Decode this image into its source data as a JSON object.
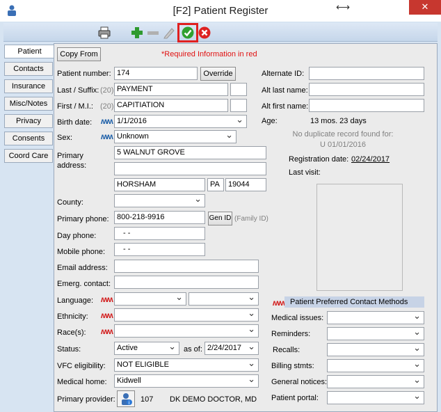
{
  "window": {
    "title": "[F2] Patient Register",
    "restore_glyph": "⟷",
    "close_glyph": "✕"
  },
  "toolbar": {
    "icons": [
      "printer-icon",
      "add-icon",
      "remove-icon",
      "edit-icon",
      "save-check-icon",
      "cancel-icon"
    ]
  },
  "tabs": [
    "Patient",
    "Contacts",
    "Insurance",
    "Misc/Notes",
    "Privacy",
    "Consents",
    "Coord Care"
  ],
  "top": {
    "copy_from": "Copy From",
    "required_note": "*Required Information in red"
  },
  "labels": {
    "patient_number": "Patient number:",
    "last_suffix": "Last / Suffix:",
    "first_mi": "First / M.I.:",
    "birth_date": "Birth date:",
    "sex": "Sex:",
    "primary_address": "Primary\naddress:",
    "county": "County:",
    "primary_phone": "Primary phone:",
    "day_phone": "Day phone:",
    "mobile_phone": "Mobile phone:",
    "email": "Email address:",
    "emerg": "Emerg. contact:",
    "language": "Language:",
    "ethnicity": "Ethnicity:",
    "race": "Race(s):",
    "status": "Status:",
    "as_of": "as of:",
    "vfc": "VFC eligibility:",
    "medical_home": "Medical home:",
    "primary_provider": "Primary provider:",
    "max20a": "(20)",
    "max20b": "(20)",
    "alternate_id": "Alternate ID:",
    "alt_last": "Alt last name:",
    "alt_first": "Alt first name:",
    "age": "Age:",
    "registration_date": "Registration date:",
    "last_visit": "Last visit:",
    "family_id": "(Family ID)"
  },
  "values": {
    "patient_number": "174",
    "last_name": "PAYMENT",
    "first_name": "CAPITIATION",
    "birth_date": "1/1/2016",
    "sex": "Unknown",
    "address1": "5 WALNUT GROVE",
    "city": "HORSHAM",
    "state": "PA",
    "zip": "19044",
    "primary_phone": "800-218-9916",
    "day_phone": "-   -",
    "mobile_phone": "-   -",
    "status": "Active",
    "status_date": "2/24/2017",
    "vfc": "NOT ELIGIBLE",
    "medical_home": "Kidwell",
    "provider_num": "107",
    "provider_name": "DK DEMO  DOCTOR, MD",
    "age": "13 mos. 23 days",
    "dup_line1": "No duplicate record found for:",
    "dup_line2": "U  01/01/2016",
    "registration_date": "02/24/2017"
  },
  "buttons": {
    "override": "Override",
    "gen_id": "Gen ID"
  },
  "contact_methods": {
    "header": "Patient Preferred Contact Methods",
    "rows": [
      "Medical issues:",
      "Reminders:",
      "Recalls:",
      "Billing stmts:",
      "General notices:",
      "Patient portal:"
    ]
  },
  "marks": {
    "mm": "ʍʍ"
  }
}
